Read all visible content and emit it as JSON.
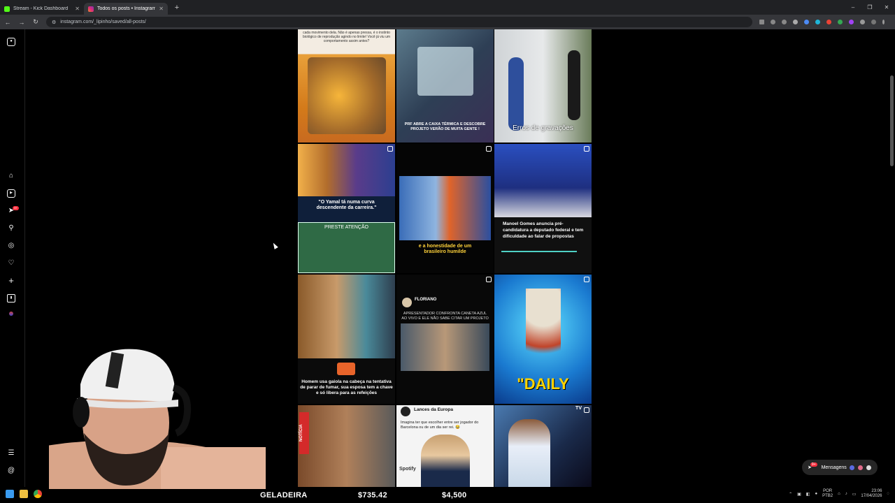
{
  "browser": {
    "tabs": [
      {
        "title": "Stream - Kick Dashboard",
        "color": "#53fc18"
      },
      {
        "title": "Todos os posts • Instagram",
        "color": "#e1306c"
      }
    ],
    "url": "instagram.com/_lipinho/saved/all-posts/"
  },
  "sidebar": {
    "icons": [
      "instagram-icon",
      "home-icon",
      "reels-icon",
      "messages-icon",
      "search-icon",
      "explore-icon",
      "notifications-icon",
      "create-icon",
      "dashboard-icon",
      "profile-icon",
      "menu-icon",
      "threads-icon"
    ],
    "messages_badge": "9+"
  },
  "posts": {
    "p1_text": "cada movimento dela. Não é apenas pressa, é o instinto biológico de reprodução agindo no limite! Você já viu um comportamento assim antes?",
    "p2_text": "PRF ABRE A CAIXA TÉRMICA E DESCOBRE PROJETO VERÃO DE MUITA GENTE !",
    "p3_text": "Erros de gravações",
    "p4_text": "\"O Yamal tá numa curva descendente da carreira.\"",
    "p4b_text": "PRESTE ATENÇÃO",
    "p5_text": "e a honestidade de um brasileiro humilde",
    "p6_text": "Manoel Gomes anuncia pré-candidatura a deputado federal e tem dificuldade ao falar de propostas",
    "p7_text": "Homem usa gaiola na cabeça na tentativa de parar de fumar, sua esposa tem a chave e só libera para as refeições",
    "p8_name": "FLORIANO",
    "p8_text": "APRESENTADOR CONFRONTA CANETA AZUL AO VIVO E ELE NÃO SABE CITAR UM PROJETO",
    "p9_text": "\"DAILY",
    "p10_text": "NOTÍCIA",
    "p11_name": "Lances da Europa",
    "p11_text": "Imagina ter que escolher entre ser jogador do Barcelona ou de um dia ser rei. 😂",
    "p11_brand": "Spotify",
    "p12_text": "TV"
  },
  "messages": {
    "label": "Mensagens",
    "badge": "9+"
  },
  "ticker": {
    "item": "GELADEIRA",
    "value1": "$735.42",
    "value2": "$4,500"
  },
  "tray": {
    "lang1": "POR",
    "lang2": "PTB2",
    "time": "23:06",
    "date": "17/04/2026"
  }
}
